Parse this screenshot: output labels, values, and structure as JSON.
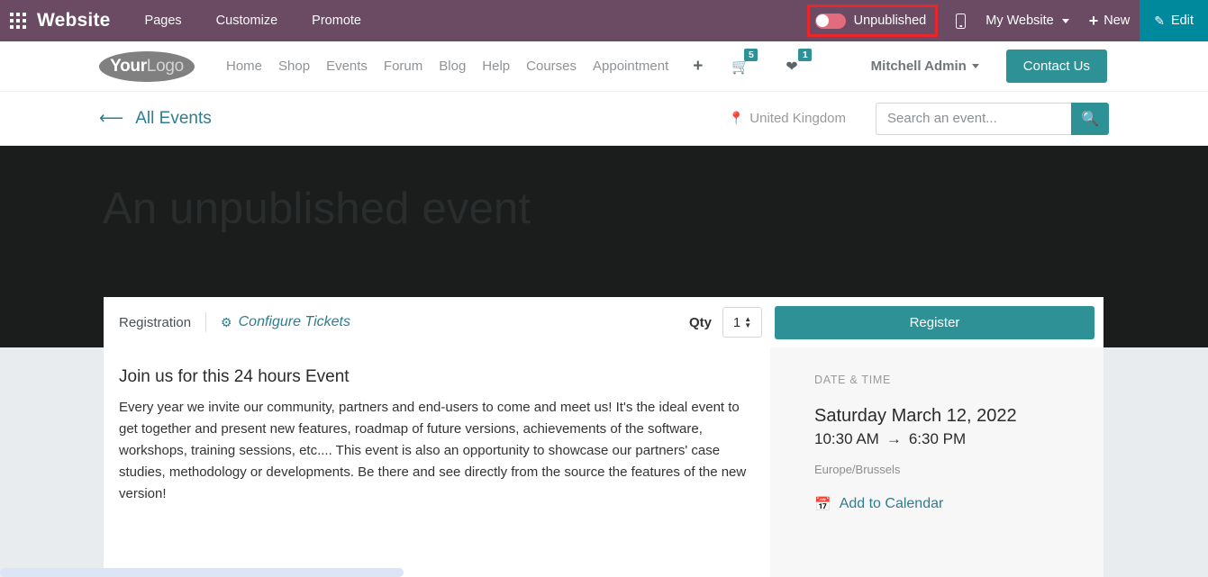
{
  "odoo_bar": {
    "apps_icon": "apps-grid-icon",
    "brand": "Website",
    "menus": [
      "Pages",
      "Customize",
      "Promote"
    ],
    "publish": {
      "state_label": "Unpublished",
      "toggle_on": false,
      "highlight_color": "#e8262c",
      "toggle_color": "#e36b7e"
    },
    "mobile_preview_icon": "mobile-preview-icon",
    "website_selector": "My Website",
    "new_label": "New",
    "new_icon": "plus-icon",
    "edit_label": "Edit",
    "edit_icon": "pencil-icon",
    "bar_color": "#6b4a63",
    "edit_color": "#00889c"
  },
  "site_nav": {
    "logo": {
      "part1": "Your",
      "part2": "Logo"
    },
    "links": [
      "Home",
      "Shop",
      "Events",
      "Forum",
      "Blog",
      "Help",
      "Courses",
      "Appointment"
    ],
    "plus_icon": "plus-icon",
    "cart": {
      "icon": "shopping-cart-icon",
      "count": "5"
    },
    "wishlist": {
      "icon": "heart-icon",
      "count": "1"
    },
    "user": "Mitchell Admin",
    "cta": "Contact Us",
    "accent_color": "#2e9196"
  },
  "sub_bar": {
    "back_icon": "arrow-left-icon",
    "back_label": "All Events",
    "location_icon": "map-pin-icon",
    "location": "United Kingdom",
    "search_placeholder": "Search an event...",
    "search_value": "",
    "search_icon": "search-icon"
  },
  "hero": {
    "title": "An unpublished event",
    "background_color": "#1b1c1c",
    "title_color": "#2a2d2e"
  },
  "registration_bar": {
    "label": "Registration",
    "configure_icon": "gear-icon",
    "configure_label": "Configure Tickets",
    "qty_label": "Qty",
    "qty_value": "1",
    "stepper_icon": "spinner-arrows-icon",
    "register_label": "Register"
  },
  "description": {
    "heading": "Join us for this 24 hours Event",
    "paragraph": "Every year we invite our community, partners and end-users to come and meet us! It's the ideal event to get together and present new features, roadmap of future versions, achievements of the software, workshops, training sessions, etc.... This event is also an opportunity to showcase our partners' case studies, methodology or developments. Be there and see directly from the source the features of the new version!"
  },
  "sidebar": {
    "section_title": "DATE & TIME",
    "date": "Saturday March 12, 2022",
    "time_start": "10:30 AM",
    "time_arrow": "→",
    "time_end": "6:30 PM",
    "timezone": "Europe/Brussels",
    "calendar_icon": "calendar-icon",
    "add_to_calendar": "Add to Calendar"
  },
  "scrollbar": {
    "orientation": "horizontal",
    "thumb_color": "#dce5f5"
  }
}
